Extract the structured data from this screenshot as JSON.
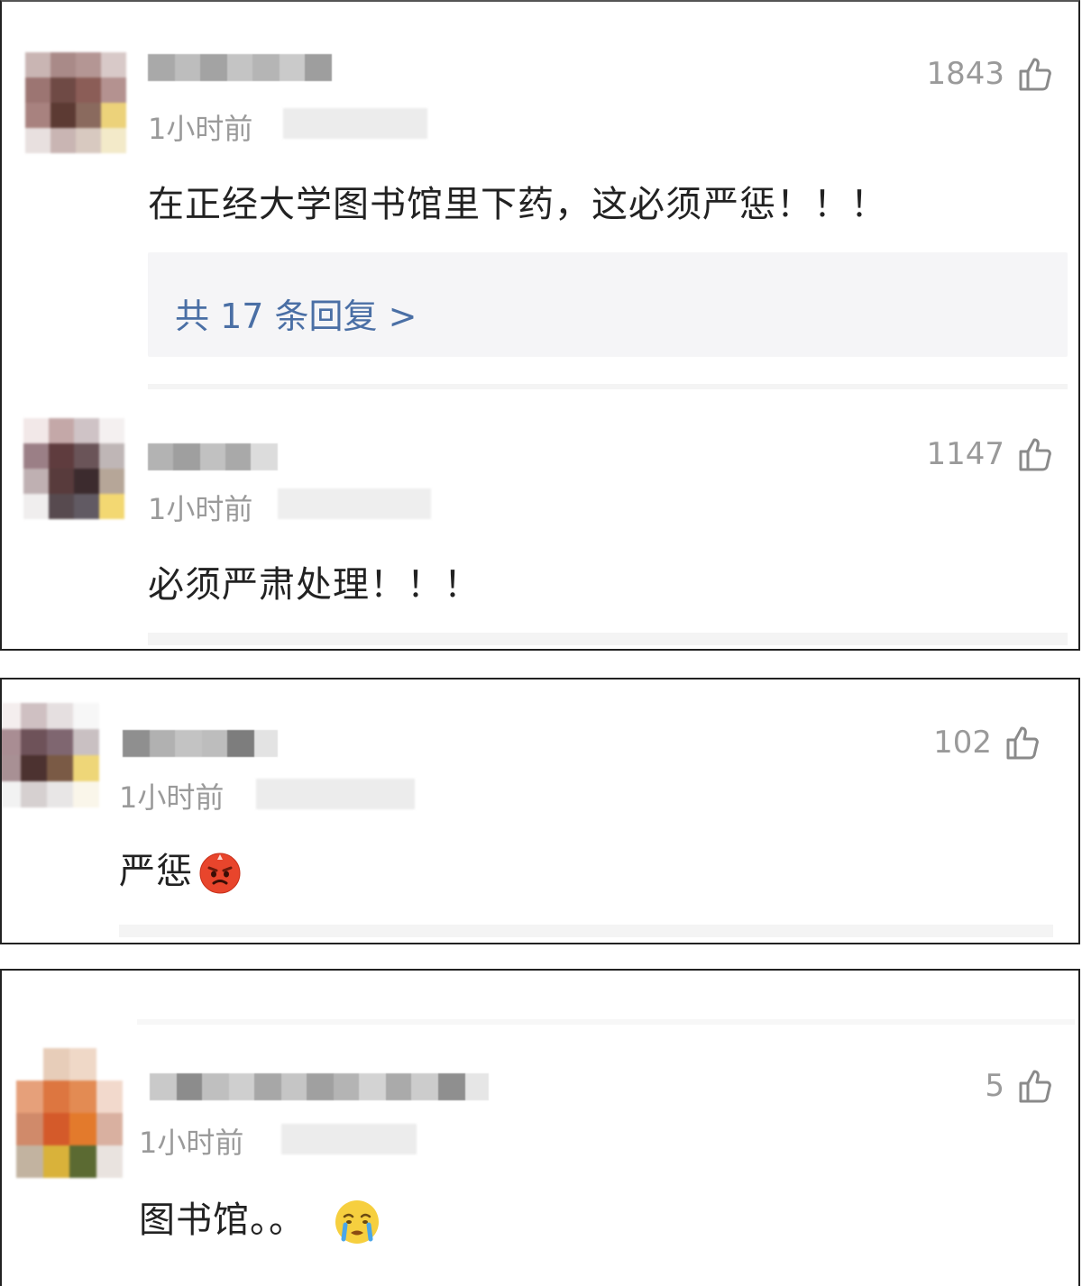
{
  "comments": [
    {
      "likes": "1843",
      "time": "1小时前",
      "text": "在正经大学图书馆里下药，这必须严惩！！！",
      "replies": "共 17 条回复 >"
    },
    {
      "likes": "1147",
      "time": "1小时前",
      "text": "必须严肃处理！！！"
    },
    {
      "likes": "102",
      "time": "1小时前",
      "text": "严惩",
      "emoji": "angry-face-emoji"
    },
    {
      "likes": "5",
      "time": "1小时前",
      "text": "图书馆。。",
      "emoji": "crying-face-emoji"
    }
  ],
  "icons": {
    "like": "thumbs-up-icon"
  },
  "colors": {
    "reply_link": "#4a6fa5",
    "muted": "#9a9a9a",
    "text": "#222222",
    "reply_bg": "#f5f5f7"
  }
}
